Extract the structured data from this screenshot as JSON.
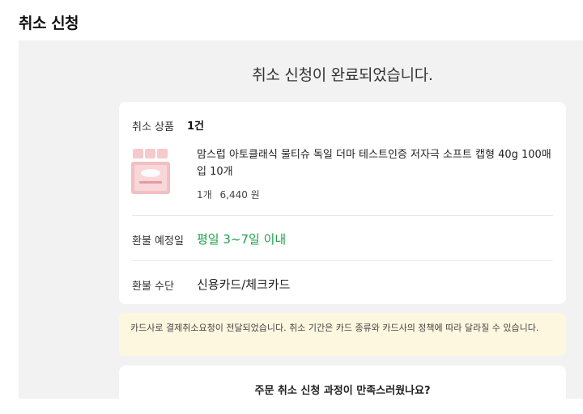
{
  "page": {
    "title": "취소 신청"
  },
  "result": {
    "headline": "취소 신청이 완료되었습니다."
  },
  "order": {
    "count_label": "취소 상품",
    "count_value": "1건",
    "product": {
      "name": "맘스럽 아토클래식 물티슈 독일 더마 테스트인증 저자극 소프트 캡형 40g 100매입 10개",
      "quantity": "1개",
      "price": "6,440 원",
      "thumbnail_icon": "wet-wipes-pack-icon"
    }
  },
  "refund": {
    "date_label": "환불 예정일",
    "date_value": "평일 3~7일 이내",
    "method_label": "환불 수단",
    "method_value": "신용카드/체크카드"
  },
  "notice": {
    "text": "카드사로 결제취소요청이 전달되었습니다. 취소 기간은 카드 종류와 카드사의 정책에 따라 달라질 수 있습니다."
  },
  "survey": {
    "question": "주문 취소 신청 과정이 만족스러웠나요?"
  },
  "colors": {
    "accent_green": "#1f9f4a",
    "panel_bg": "#f2f2f2",
    "notice_bg": "#fdf7e0"
  }
}
